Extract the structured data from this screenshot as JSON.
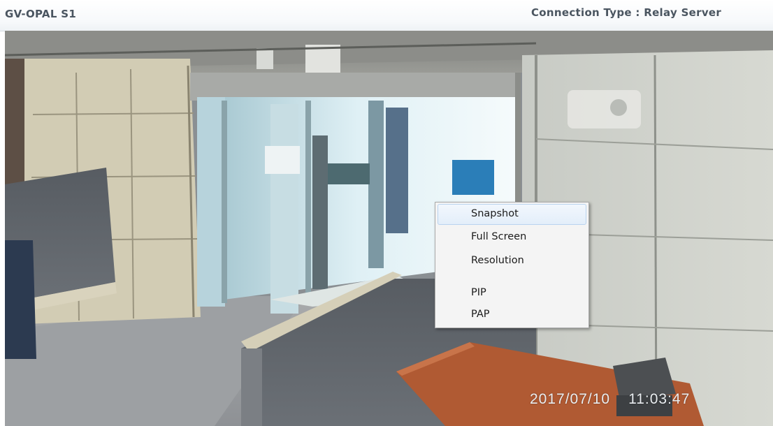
{
  "header": {
    "device_name": "GV-OPAL S1",
    "connection_label": "Connection Type : Relay Server"
  },
  "video": {
    "osd_date": "2017/07/10",
    "osd_time": "11:03:47"
  },
  "context_menu": {
    "items": [
      {
        "label": "Snapshot"
      },
      {
        "label": "Full Screen"
      },
      {
        "label": "Resolution"
      },
      {
        "label": "PIP"
      },
      {
        "label": "PAP"
      }
    ],
    "highlighted": "Snapshot"
  },
  "colors": {
    "header_text": "#4a5560",
    "osd_text": "#e9edf0",
    "menu_background": "#f4f4f4",
    "menu_highlight": "#e3eefa"
  }
}
